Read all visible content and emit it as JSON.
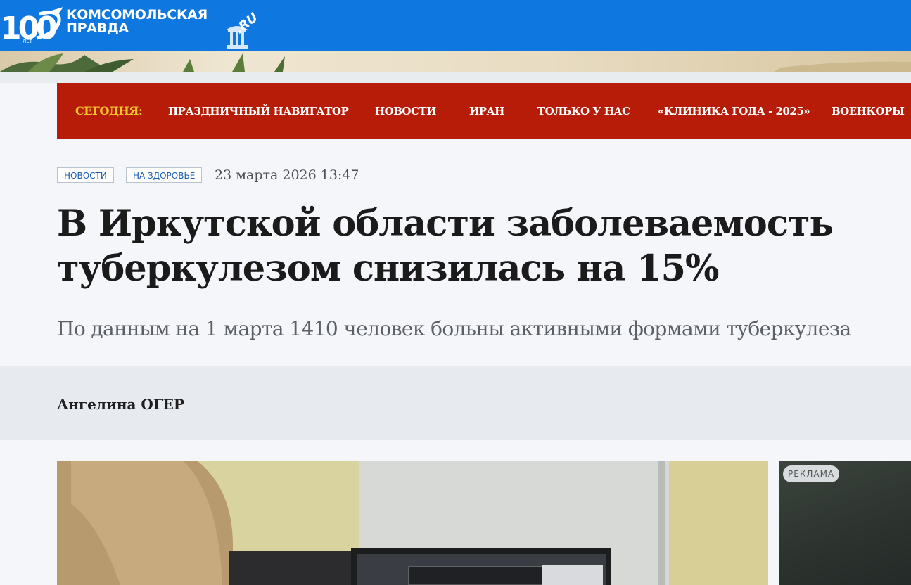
{
  "header": {
    "logo_anniversary": "100",
    "logo_anniversary_sub": "ЛЕТ",
    "logo_line1": "Комсомольская",
    "logo_line2": "правда",
    "logo_domain": ".RU"
  },
  "nav": {
    "today_label": "СЕГОДНЯ:",
    "items": [
      "ПРАЗДНИЧНЫЙ НАВИГАТОР",
      "НОВОСТИ",
      "ИРАН",
      "ТОЛЬКО У НАС",
      "«КЛИНИКА ГОДА - 2025»",
      "ВОЕНКОРЫ"
    ]
  },
  "article": {
    "tags": [
      "Новости",
      "На здоровье"
    ],
    "date": "23 марта 2026 13:47",
    "title": "В Иркутской области заболеваемость туберкулезом снизилась на 15%",
    "subtitle": "По данным на 1 марта 1410 человек больны активными формами туберкулеза",
    "author": "Ангелина ОГЕР"
  },
  "ad": {
    "badge": "РЕКЛАМА"
  },
  "colors": {
    "topbar": "#0f78e0",
    "nav_red": "#b71c08",
    "today_yellow": "#f7c52b",
    "tag_blue": "#1a5fb4"
  }
}
